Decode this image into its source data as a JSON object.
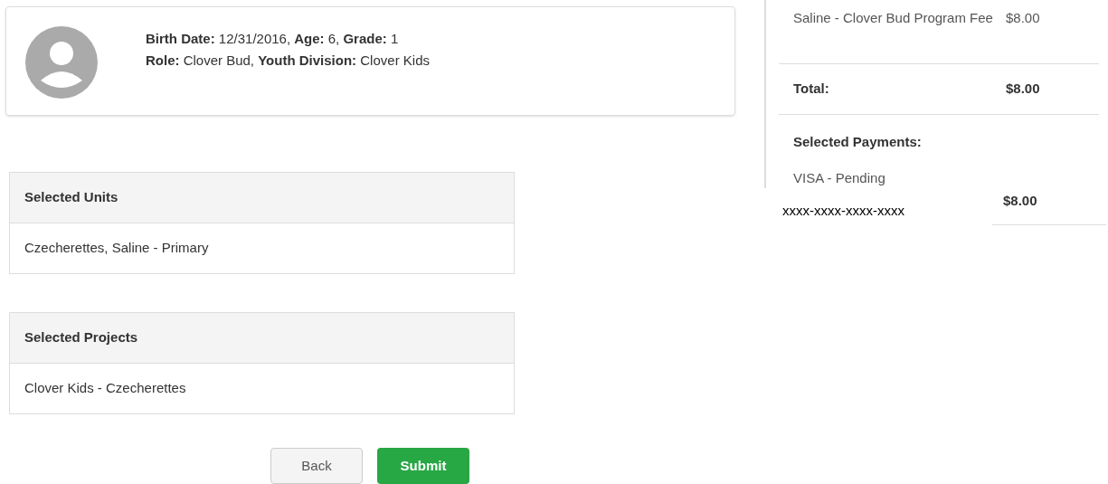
{
  "profile": {
    "lines": [
      "**Birth Date:** 12/31/2016, **Age:** 6, **Grade:** 1",
      "**Role:** Clover Bud, **Youth Division:** Clover Kids"
    ]
  },
  "sections": [
    {
      "title": "Selected Units",
      "body": "Czecherettes, Saline - Primary"
    },
    {
      "title": "Selected Projects",
      "body": "Clover Kids - Czecherettes"
    }
  ],
  "buttons": [
    {
      "kind": "secondary",
      "label": "Back"
    },
    {
      "kind": "primary",
      "label": "Submit"
    }
  ],
  "summary": {
    "fee": {
      "label": "Saline - Clover Bud Program Fee",
      "amount": "$8.00"
    },
    "total": {
      "label": "Total:",
      "amount": "$8.00"
    },
    "payments_title": "Selected Payments:",
    "payment": {
      "method": "VISA - Pending",
      "card": "xxxx-xxxx-xxxx-xxxx",
      "amount": "$8.00"
    }
  }
}
